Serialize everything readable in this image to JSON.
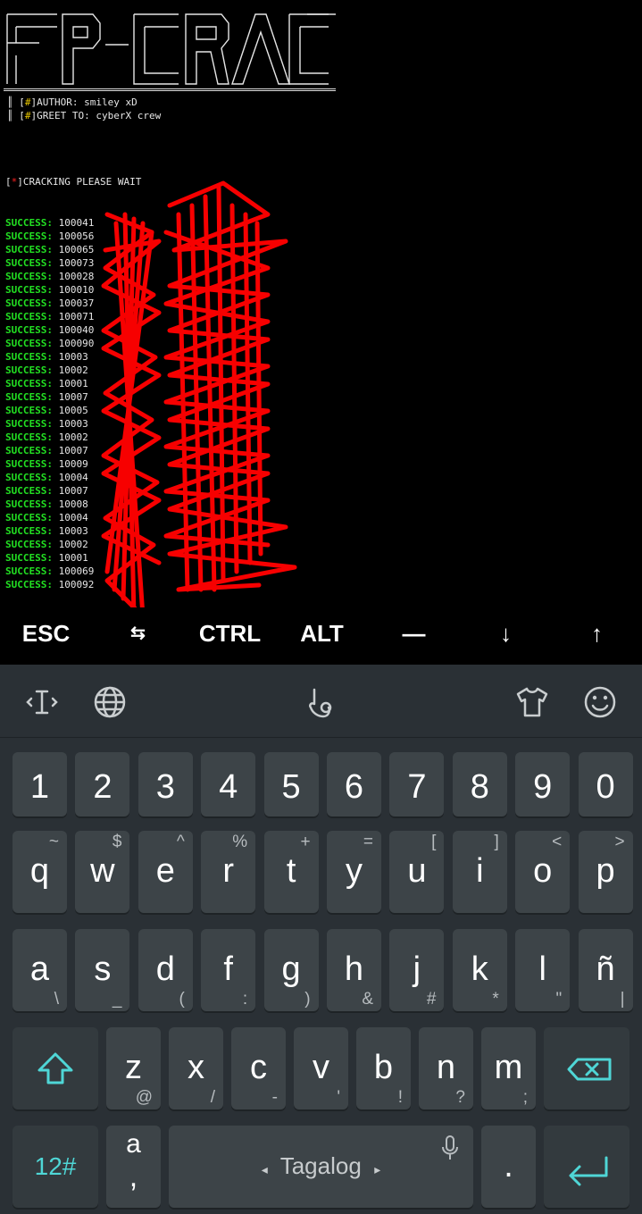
{
  "terminal": {
    "info": {
      "author_label": "[#]AUTHOR: smiley xD",
      "greet_label": "[#]GREET TO: cyberX crew"
    },
    "status": "[*]CRACKING PLEASE WAIT",
    "result_tag": "SUCCESS:",
    "results": [
      {
        "id": "100041",
        "rest": ""
      },
      {
        "id": "100056",
        "rest": ""
      },
      {
        "id": "100065",
        "rest": ""
      },
      {
        "id": "100073",
        "rest": ""
      },
      {
        "id": "100028",
        "rest": ""
      },
      {
        "id": "100010",
        "rest": ""
      },
      {
        "id": "100037",
        "rest": ""
      },
      {
        "id": "100071",
        "rest": ""
      },
      {
        "id": "100040",
        "rest": ""
      },
      {
        "id": "100090",
        "rest": ""
      },
      {
        "id": "10003",
        "rest": ""
      },
      {
        "id": "10002",
        "rest": ""
      },
      {
        "id": "10001",
        "rest": ""
      },
      {
        "id": "10007",
        "rest": ""
      },
      {
        "id": "10005",
        "rest": ""
      },
      {
        "id": "10003",
        "rest": ""
      },
      {
        "id": "10002",
        "rest": ""
      },
      {
        "id": "10007",
        "rest": ""
      },
      {
        "id": "10009",
        "rest": ""
      },
      {
        "id": "10004",
        "rest": ""
      },
      {
        "id": "10007",
        "rest": ""
      },
      {
        "id": "10008",
        "rest": ""
      },
      {
        "id": "10004",
        "rest": ""
      },
      {
        "id": "10003",
        "rest": ""
      },
      {
        "id": "10002",
        "rest": ""
      },
      {
        "id": "10001",
        "rest": ""
      },
      {
        "id": "100069",
        "rest": ""
      },
      {
        "id": "100092",
        "rest": ""
      }
    ]
  },
  "extra_keys": {
    "esc": "ESC",
    "tab": "⇆",
    "ctrl": "CTRL",
    "alt": "ALT",
    "dash": "—",
    "down": "↓",
    "up": "↑"
  },
  "keyboard": {
    "toolbar_icons": [
      "text-cursor-icon",
      "globe-icon",
      "gesture-hand-icon",
      "theme-shirt-icon",
      "emoji-icon"
    ],
    "number_row": [
      "1",
      "2",
      "3",
      "4",
      "5",
      "6",
      "7",
      "8",
      "9",
      "0"
    ],
    "row1": [
      {
        "key": "q",
        "sub": "~"
      },
      {
        "key": "w",
        "sub": "$"
      },
      {
        "key": "e",
        "sub": "^"
      },
      {
        "key": "r",
        "sub": "%"
      },
      {
        "key": "t",
        "sub": "+"
      },
      {
        "key": "y",
        "sub": "="
      },
      {
        "key": "u",
        "sub": "["
      },
      {
        "key": "i",
        "sub": "]"
      },
      {
        "key": "o",
        "sub": "<"
      },
      {
        "key": "p",
        "sub": ">"
      }
    ],
    "row2": [
      {
        "key": "a",
        "sub": "\\"
      },
      {
        "key": "s",
        "sub": "_"
      },
      {
        "key": "d",
        "sub": "("
      },
      {
        "key": "f",
        "sub": ":"
      },
      {
        "key": "g",
        "sub": ")"
      },
      {
        "key": "h",
        "sub": "&"
      },
      {
        "key": "j",
        "sub": "#"
      },
      {
        "key": "k",
        "sub": "*"
      },
      {
        "key": "l",
        "sub": "\""
      },
      {
        "key": "ñ",
        "sub": "|"
      }
    ],
    "row3": [
      {
        "key": "z",
        "sub": "@"
      },
      {
        "key": "x",
        "sub": "/"
      },
      {
        "key": "c",
        "sub": "-"
      },
      {
        "key": "v",
        "sub": "'"
      },
      {
        "key": "b",
        "sub": "!"
      },
      {
        "key": "n",
        "sub": "?"
      },
      {
        "key": "m",
        "sub": ";"
      }
    ],
    "symbols_key": "12#",
    "comma_key_main": "a",
    "comma_key_sub": ",",
    "space_label": "Tagalog",
    "period_key": ".",
    "accent_color": "#4fd6d6"
  }
}
